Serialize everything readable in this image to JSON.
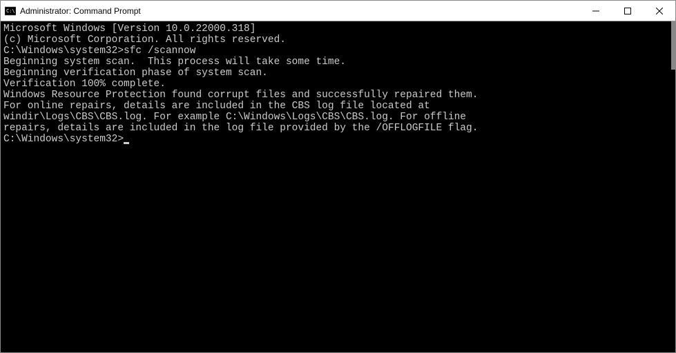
{
  "window": {
    "title": "Administrator: Command Prompt"
  },
  "terminal": {
    "line1": "Microsoft Windows [Version 10.0.22000.318]",
    "line2": "(c) Microsoft Corporation. All rights reserved.",
    "blank1": "",
    "prompt1_path": "C:\\Windows\\system32>",
    "prompt1_cmd": "sfc /scannow",
    "blank2": "",
    "line3": "Beginning system scan.  This process will take some time.",
    "blank3": "",
    "line4": "Beginning verification phase of system scan.",
    "line5": "Verification 100% complete.",
    "blank4": "",
    "line6": "Windows Resource Protection found corrupt files and successfully repaired them.",
    "line7": "For online repairs, details are included in the CBS log file located at",
    "line8": "windir\\Logs\\CBS\\CBS.log. For example C:\\Windows\\Logs\\CBS\\CBS.log. For offline",
    "line9": "repairs, details are included in the log file provided by the /OFFLOGFILE flag.",
    "blank5": "",
    "prompt2_path": "C:\\Windows\\system32>"
  }
}
